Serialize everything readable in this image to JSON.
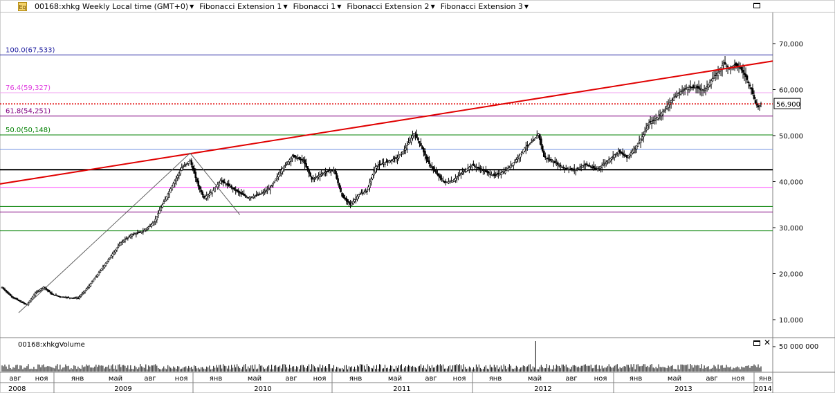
{
  "toolbar": {
    "symbol_icon": "Eq",
    "title": "00168:xhkg Weekly Local time (GMT+0)",
    "menus": [
      "Fibonacci Extension 1",
      "Fibonacci 1",
      "Fibonacci Extension 2",
      "Fibonacci Extension 3"
    ]
  },
  "volume_panel": {
    "title": "00168:xhkgVolume"
  },
  "colors": {
    "fib_100": "#2020a0",
    "fib_764": "#e040e0",
    "fib_618": "#800080",
    "fib_50": "#008000",
    "trendline": "#e00000",
    "price_line": "#e00000"
  },
  "chart_data": {
    "type": "candlestick",
    "timeframe": "Weekly",
    "y_price": {
      "ylim": [
        5000,
        75000
      ],
      "ticks": [
        "10,000",
        "20,000",
        "30,000",
        "40,000",
        "50,000",
        "60,000",
        "70,000"
      ],
      "tick_values": [
        10000,
        20000,
        30000,
        40000,
        50000,
        60000,
        70000
      ]
    },
    "y_volume": {
      "ticks": [
        "50 000 000"
      ],
      "tick_values": [
        50000000
      ]
    },
    "x_months": [
      "авг",
      "ноя",
      "янв",
      "май",
      "авг",
      "ноя",
      "янв",
      "май",
      "авг",
      "ноя",
      "янв",
      "май",
      "авг",
      "ноя",
      "янв",
      "май",
      "авг",
      "ноя",
      "янв",
      "май",
      "авг",
      "ноя",
      "янв"
    ],
    "x_years": [
      "2008",
      "2009",
      "2010",
      "2011",
      "2012",
      "2013",
      "2014"
    ],
    "last_price": {
      "label": "56,900",
      "value": 56900
    },
    "fib_levels": [
      {
        "label": "100.0(67,533)",
        "value": 67533,
        "color": "#2020a0"
      },
      {
        "label": "76.4(59,327)",
        "value": 59327,
        "color": "#e040e0"
      },
      {
        "label": "61.8(54,251)",
        "value": 54251,
        "color": "#800080"
      },
      {
        "label": "50.0(50,148)",
        "value": 50148,
        "color": "#008000"
      }
    ],
    "hlines": [
      {
        "value": 47000,
        "color": "#7090e0"
      },
      {
        "value": 42600,
        "color": "#000000"
      },
      {
        "value": 38700,
        "color": "#ff40ff"
      },
      {
        "value": 34600,
        "color": "#008000"
      },
      {
        "value": 33400,
        "color": "#800080"
      },
      {
        "value": 29300,
        "color": "#008000"
      }
    ],
    "trendline": {
      "start": 39500,
      "end": 66200
    },
    "price_anchors": [
      [
        0,
        17000
      ],
      [
        6,
        15200
      ],
      [
        12,
        14100
      ],
      [
        18,
        13200
      ],
      [
        24,
        15800
      ],
      [
        30,
        17100
      ],
      [
        36,
        15500
      ],
      [
        42,
        15000
      ],
      [
        48,
        14800
      ],
      [
        55,
        14700
      ],
      [
        62,
        17000
      ],
      [
        70,
        20200
      ],
      [
        78,
        23500
      ],
      [
        86,
        26800
      ],
      [
        94,
        28500
      ],
      [
        102,
        29200
      ],
      [
        110,
        31200
      ],
      [
        116,
        35000
      ],
      [
        122,
        38500
      ],
      [
        130,
        43000
      ],
      [
        136,
        44600
      ],
      [
        142,
        39000
      ],
      [
        146,
        36500
      ],
      [
        152,
        37800
      ],
      [
        158,
        40200
      ],
      [
        166,
        38700
      ],
      [
        172,
        37500
      ],
      [
        178,
        36500
      ],
      [
        186,
        37200
      ],
      [
        194,
        38600
      ],
      [
        202,
        42500
      ],
      [
        210,
        45500
      ],
      [
        218,
        44500
      ],
      [
        224,
        40500
      ],
      [
        232,
        41800
      ],
      [
        240,
        42600
      ],
      [
        246,
        36800
      ],
      [
        252,
        35000
      ],
      [
        258,
        37200
      ],
      [
        264,
        38000
      ],
      [
        270,
        43200
      ],
      [
        278,
        44300
      ],
      [
        286,
        45200
      ],
      [
        292,
        47300
      ],
      [
        298,
        50500
      ],
      [
        302,
        48500
      ],
      [
        308,
        44300
      ],
      [
        314,
        41800
      ],
      [
        320,
        39800
      ],
      [
        326,
        40200
      ],
      [
        332,
        41800
      ],
      [
        340,
        43600
      ],
      [
        348,
        42400
      ],
      [
        356,
        41300
      ],
      [
        364,
        42300
      ],
      [
        372,
        44800
      ],
      [
        378,
        47300
      ],
      [
        384,
        48800
      ],
      [
        388,
        50400
      ],
      [
        392,
        45400
      ],
      [
        398,
        44400
      ],
      [
        406,
        43000
      ],
      [
        414,
        42500
      ],
      [
        422,
        43800
      ],
      [
        430,
        42600
      ],
      [
        438,
        44500
      ],
      [
        446,
        46600
      ],
      [
        452,
        45200
      ],
      [
        458,
        47400
      ],
      [
        464,
        50200
      ],
      [
        468,
        52800
      ],
      [
        472,
        53400
      ],
      [
        478,
        55200
      ],
      [
        484,
        57600
      ],
      [
        490,
        59400
      ],
      [
        496,
        60500
      ],
      [
        502,
        60400
      ],
      [
        508,
        59900
      ],
      [
        514,
        62400
      ],
      [
        518,
        63700
      ],
      [
        522,
        65800
      ],
      [
        526,
        64600
      ],
      [
        530,
        65400
      ],
      [
        534,
        64700
      ],
      [
        538,
        62800
      ],
      [
        542,
        60100
      ],
      [
        545,
        57000
      ],
      [
        547,
        56200
      ],
      [
        549,
        56900
      ]
    ],
    "volume_spike_index": 386
  }
}
